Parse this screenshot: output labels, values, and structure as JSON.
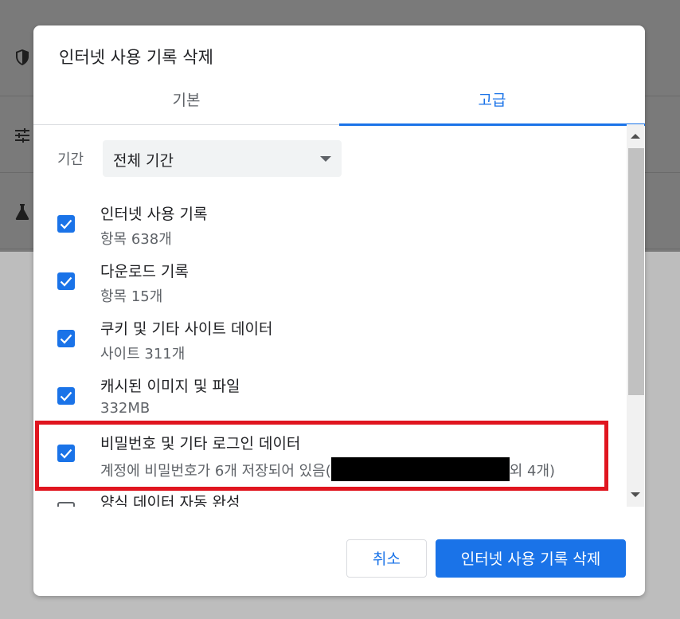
{
  "dialog": {
    "title": "인터넷 사용 기록 삭제",
    "tabs": [
      {
        "label": "기본",
        "selected": false
      },
      {
        "label": "고급",
        "selected": true
      }
    ],
    "time_range": {
      "label": "기간",
      "selected_value": "전체 기간"
    },
    "items": [
      {
        "label": "인터넷 사용 기록",
        "detail": "항목 638개",
        "checked": true
      },
      {
        "label": "다운로드 기록",
        "detail": "항목 15개",
        "checked": true
      },
      {
        "label": "쿠키 및 기타 사이트 데이터",
        "detail": "사이트 311개",
        "checked": true
      },
      {
        "label": "캐시된 이미지 및 파일",
        "detail": "332MB",
        "checked": true
      },
      {
        "label": "비밀번호 및 기타 로그인 데이터",
        "detail_prefix": "계정에 비밀번호가 6개 저장되어 있음(",
        "detail_suffix": "외 4개)",
        "checked": true,
        "highlighted": true
      },
      {
        "label": "양식 데이터 자동 완성",
        "detail": "",
        "checked": false
      }
    ],
    "buttons": {
      "cancel": "취소",
      "confirm": "인터넷 사용 기록 삭제"
    }
  },
  "colors": {
    "accent": "#1a73e8",
    "highlight": "#e0151f"
  }
}
